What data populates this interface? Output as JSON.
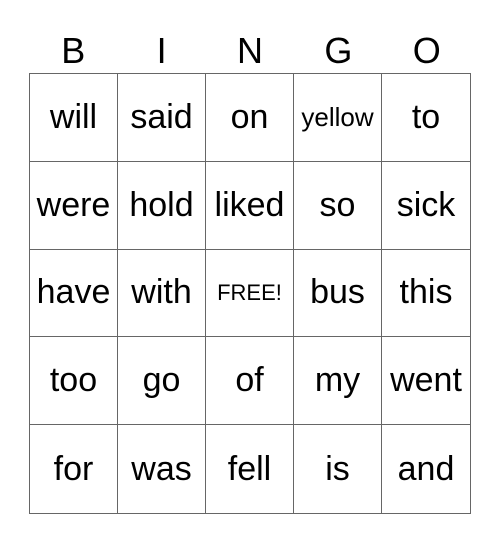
{
  "header": [
    "B",
    "I",
    "N",
    "G",
    "O"
  ],
  "cells": [
    [
      "will",
      "said",
      "on",
      "yellow",
      "to"
    ],
    [
      "were",
      "hold",
      "liked",
      "so",
      "sick"
    ],
    [
      "have",
      "with",
      "FREE!",
      "bus",
      "this"
    ],
    [
      "too",
      "go",
      "of",
      "my",
      "went"
    ],
    [
      "for",
      "was",
      "fell",
      "is",
      "and"
    ]
  ]
}
